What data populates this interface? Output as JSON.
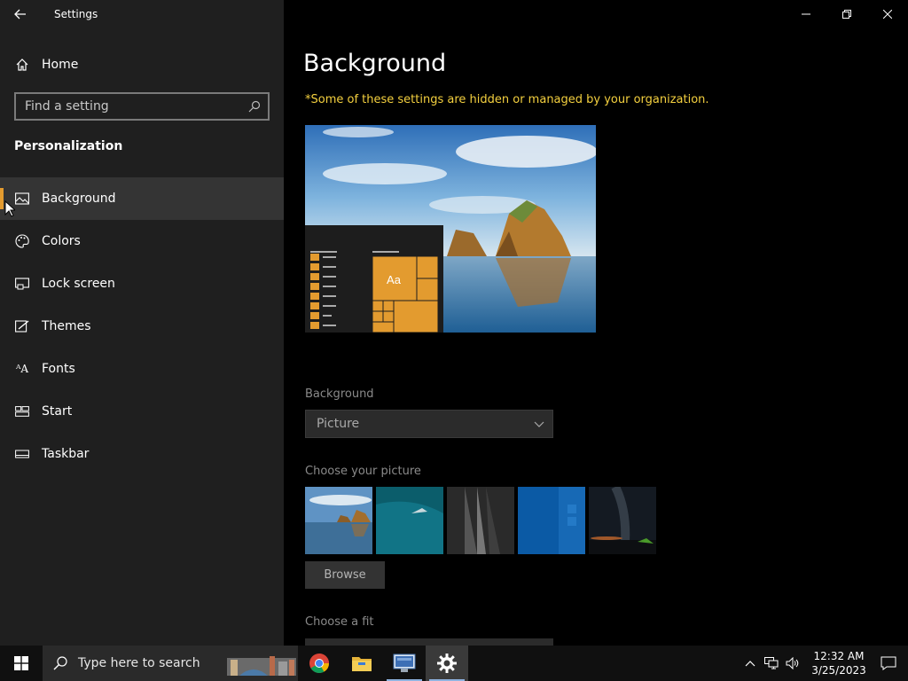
{
  "window": {
    "title": "Settings"
  },
  "sidebar": {
    "home_label": "Home",
    "search_placeholder": "Find a setting",
    "section_title": "Personalization",
    "items": [
      {
        "label": "Background",
        "icon": "image-icon",
        "active": true
      },
      {
        "label": "Colors",
        "icon": "palette-icon"
      },
      {
        "label": "Lock screen",
        "icon": "lock-screen-icon"
      },
      {
        "label": "Themes",
        "icon": "themes-icon"
      },
      {
        "label": "Fonts",
        "icon": "fonts-icon"
      },
      {
        "label": "Start",
        "icon": "start-icon"
      },
      {
        "label": "Taskbar",
        "icon": "taskbar-icon"
      }
    ]
  },
  "main": {
    "page_title": "Background",
    "org_note": "*Some of these settings are hidden or managed by your organization.",
    "preview_tile_text": "Aa",
    "background_label": "Background",
    "background_value": "Picture",
    "choose_picture_label": "Choose your picture",
    "browse_label": "Browse",
    "choose_fit_label": "Choose a fit"
  },
  "taskbar": {
    "search_placeholder": "Type here to search",
    "apps": [
      "chrome-icon",
      "file-explorer-icon",
      "remote-desktop-icon",
      "settings-gear-icon"
    ],
    "time": "12:32 AM",
    "date": "3/25/2023"
  },
  "colors": {
    "accent": "#e39b2f",
    "warning_text": "#f4d03f"
  }
}
